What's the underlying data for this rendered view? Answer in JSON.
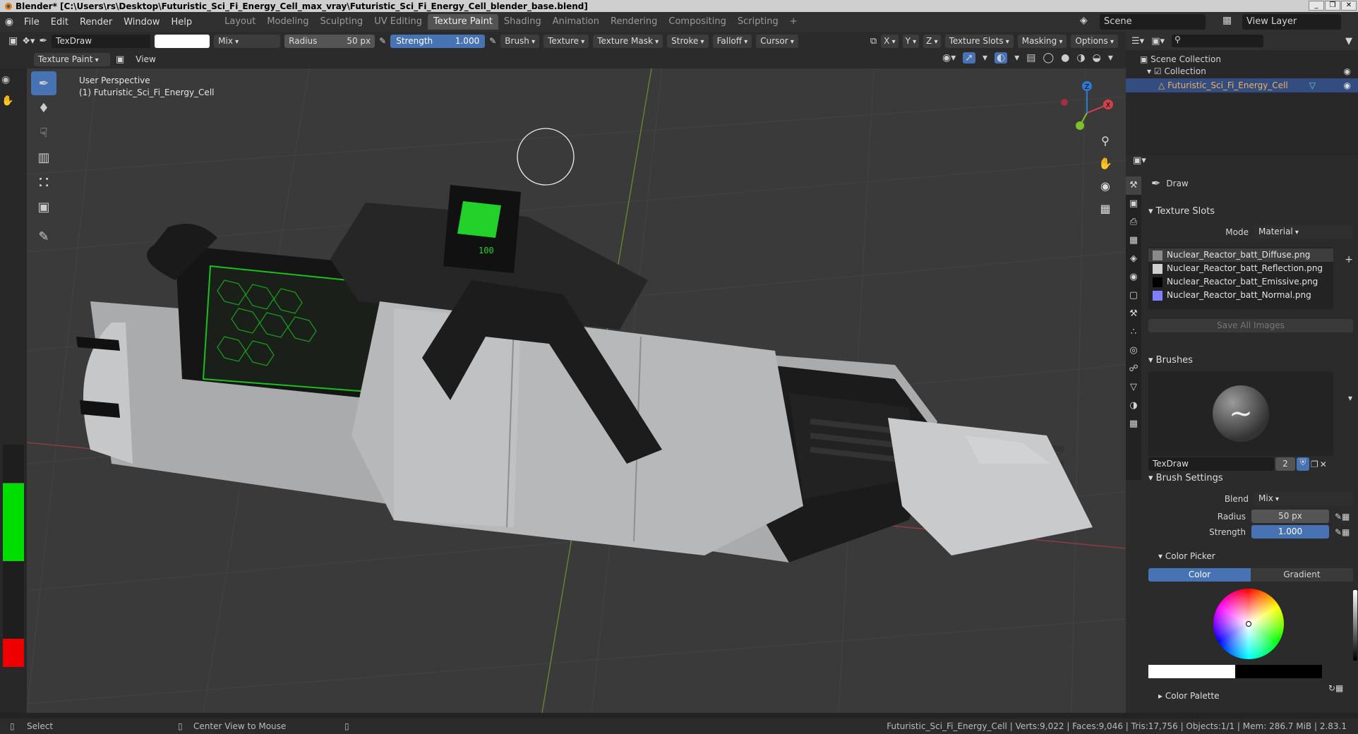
{
  "window": {
    "title": "Blender* [C:\\Users\\rs\\Desktop\\Futuristic_Sci_Fi_Energy_Cell_max_vray\\Futuristic_Sci_Fi_Energy_Cell_blender_base.blend]",
    "controls": [
      "_",
      "❒",
      "✕"
    ]
  },
  "menubar": {
    "menus": [
      "File",
      "Edit",
      "Render",
      "Window",
      "Help"
    ],
    "workspaces": [
      "Layout",
      "Modeling",
      "Sculpting",
      "UV Editing",
      "Texture Paint",
      "Shading",
      "Animation",
      "Rendering",
      "Compositing",
      "Scripting"
    ],
    "active_workspace": "Texture Paint",
    "add_tab": "+",
    "scene": "Scene",
    "view_layer": "View Layer"
  },
  "tool_header": {
    "brush_name": "TexDraw",
    "blend": "Mix",
    "radius_label": "Radius",
    "radius_value": "50 px",
    "strength_label": "Strength",
    "strength_value": "1.000",
    "menus": [
      "Brush",
      "Texture",
      "Texture Mask",
      "Stroke",
      "Falloff",
      "Cursor"
    ],
    "axes": [
      "X",
      "Y",
      "Z"
    ],
    "right_menus": [
      "Texture Slots",
      "Masking",
      "Options"
    ]
  },
  "mode_header": {
    "mode": "Texture Paint",
    "view": "View"
  },
  "viewport": {
    "perspective": "User Perspective",
    "object": "(1) Futuristic_Sci_Fi_Energy_Cell",
    "screen_text": "100",
    "gizmo_axes": [
      "Z",
      "X"
    ],
    "background": "#3a3a3a",
    "grid_color": "#444444",
    "x_axis_color": "#9c3a42",
    "y_axis_color": "#6a8d2a"
  },
  "outliner": {
    "scene_collection": "Scene Collection",
    "collection": "Collection",
    "object": "Futuristic_Sci_Fi_Energy_Cell"
  },
  "properties": {
    "tool_name": "Draw",
    "texture_slots": {
      "title": "Texture Slots",
      "mode_label": "Mode",
      "mode_value": "Material",
      "slots": [
        {
          "name": "Nuclear_Reactor_batt_Diffuse.png",
          "color": "#8a8a8a",
          "selected": true
        },
        {
          "name": "Nuclear_Reactor_batt_Reflection.png",
          "color": "#d0d0d0",
          "selected": false
        },
        {
          "name": "Nuclear_Reactor_batt_Emissive.png",
          "color": "#000000",
          "selected": false
        },
        {
          "name": "Nuclear_Reactor_batt_Normal.png",
          "color": "#8080ff",
          "selected": false
        }
      ],
      "save_all": "Save All Images"
    },
    "brushes": {
      "title": "Brushes",
      "brush_name": "TexDraw",
      "users": "2"
    },
    "brush_settings": {
      "title": "Brush Settings",
      "blend_label": "Blend",
      "blend_value": "Mix",
      "radius_label": "Radius",
      "radius_value": "50 px",
      "strength_label": "Strength",
      "strength_value": "1.000"
    },
    "color_picker": {
      "title": "Color Picker",
      "tabs": [
        "Color",
        "Gradient"
      ],
      "active_tab": "Color",
      "primary": "#ffffff",
      "secondary": "#000000"
    },
    "color_palette": "Color Palette"
  },
  "left_color_bar": {
    "green": "#00dd00",
    "red": "#ee0000"
  },
  "status": {
    "left": [
      "Select",
      "Center View to Mouse"
    ],
    "right": "Futuristic_Sci_Fi_Energy_Cell | Verts:9,022 | Faces:9,046 | Tris:17,756 | Objects:1/1 | Mem: 286.7 MiB | 2.83.1"
  }
}
